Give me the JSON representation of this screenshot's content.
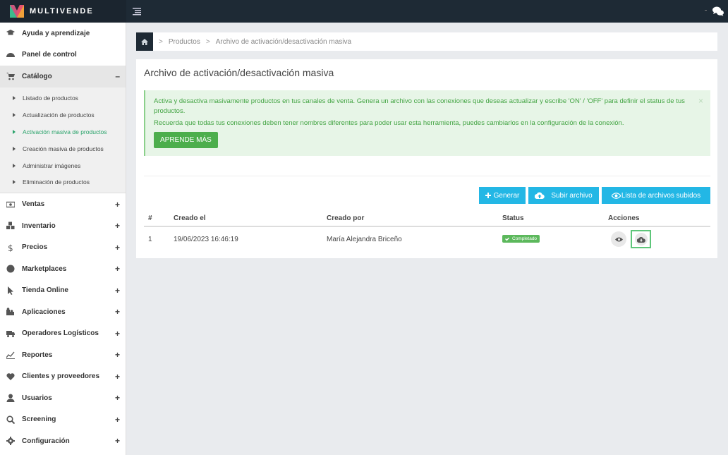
{
  "app": {
    "brand": "MULTIVENDE"
  },
  "sidebar": {
    "items": [
      {
        "label": "Ayuda y aprendizaje",
        "icon": "graduation-cap-icon"
      },
      {
        "label": "Panel de control",
        "icon": "dashboard-icon"
      },
      {
        "label": "Catálogo",
        "icon": "cart-icon",
        "expanded": true,
        "toggle": "–",
        "children": [
          {
            "label": "Listado de productos"
          },
          {
            "label": "Actualización de productos"
          },
          {
            "label": "Activación masiva de productos",
            "active": true
          },
          {
            "label": "Creación masiva de productos"
          },
          {
            "label": "Administrar imágenes"
          },
          {
            "label": "Eliminación de productos"
          }
        ]
      },
      {
        "label": "Ventas",
        "icon": "money-icon",
        "toggle": "+"
      },
      {
        "label": "Inventario",
        "icon": "cubes-icon",
        "toggle": "+"
      },
      {
        "label": "Precios",
        "icon": "dollar-icon",
        "toggle": "+"
      },
      {
        "label": "Marketplaces",
        "icon": "globe-icon",
        "toggle": "+"
      },
      {
        "label": "Tienda Online",
        "icon": "pointer-icon",
        "toggle": "+"
      },
      {
        "label": "Aplicaciones",
        "icon": "puzzle-icon",
        "toggle": "+"
      },
      {
        "label": "Operadores Logísticos",
        "icon": "truck-icon",
        "toggle": "+"
      },
      {
        "label": "Reportes",
        "icon": "line-chart-icon",
        "toggle": "+"
      },
      {
        "label": "Clientes y proveedores",
        "icon": "heart-icon",
        "toggle": "+"
      },
      {
        "label": "Usuarios",
        "icon": "user-icon",
        "toggle": "+"
      },
      {
        "label": "Screening",
        "icon": "search-icon",
        "toggle": "+"
      },
      {
        "label": "Configuración",
        "icon": "gear-icon",
        "toggle": "+"
      }
    ]
  },
  "breadcrumb": {
    "sep": ">",
    "items": [
      "Productos",
      "Archivo de activación/desactivación masiva"
    ]
  },
  "page": {
    "title": "Archivo de activación/desactivación masiva"
  },
  "alert": {
    "line1": "Activa y desactiva masivamente productos en tus canales de venta. Genera un archivo con las conexiones que deseas actualizar y escribe 'ON' / 'OFF' para definir el status de tus productos.",
    "line2": "Recuerda que todas tus conexiones deben tener nombres diferentes para poder usar esta herramienta, puedes cambiarlos en la configuración de la conexión.",
    "button": "APRENDE MÁS",
    "close": "×"
  },
  "actions": {
    "generate": "Generar",
    "upload": "Subir archivo",
    "list": "Lista de archivos subidos"
  },
  "table": {
    "headers": [
      "#",
      "Creado el",
      "Creado por",
      "Status",
      "Acciones"
    ],
    "rows": [
      {
        "id": "1",
        "created_at": "19/06/2023 16:46:19",
        "created_by": "María Alejandra Briceño",
        "status": "Completado"
      }
    ]
  },
  "colors": {
    "accent": "#23b7e5",
    "success": "#5cb85c",
    "active_nav": "#2aa36b",
    "topbar": "#1e2a35"
  }
}
